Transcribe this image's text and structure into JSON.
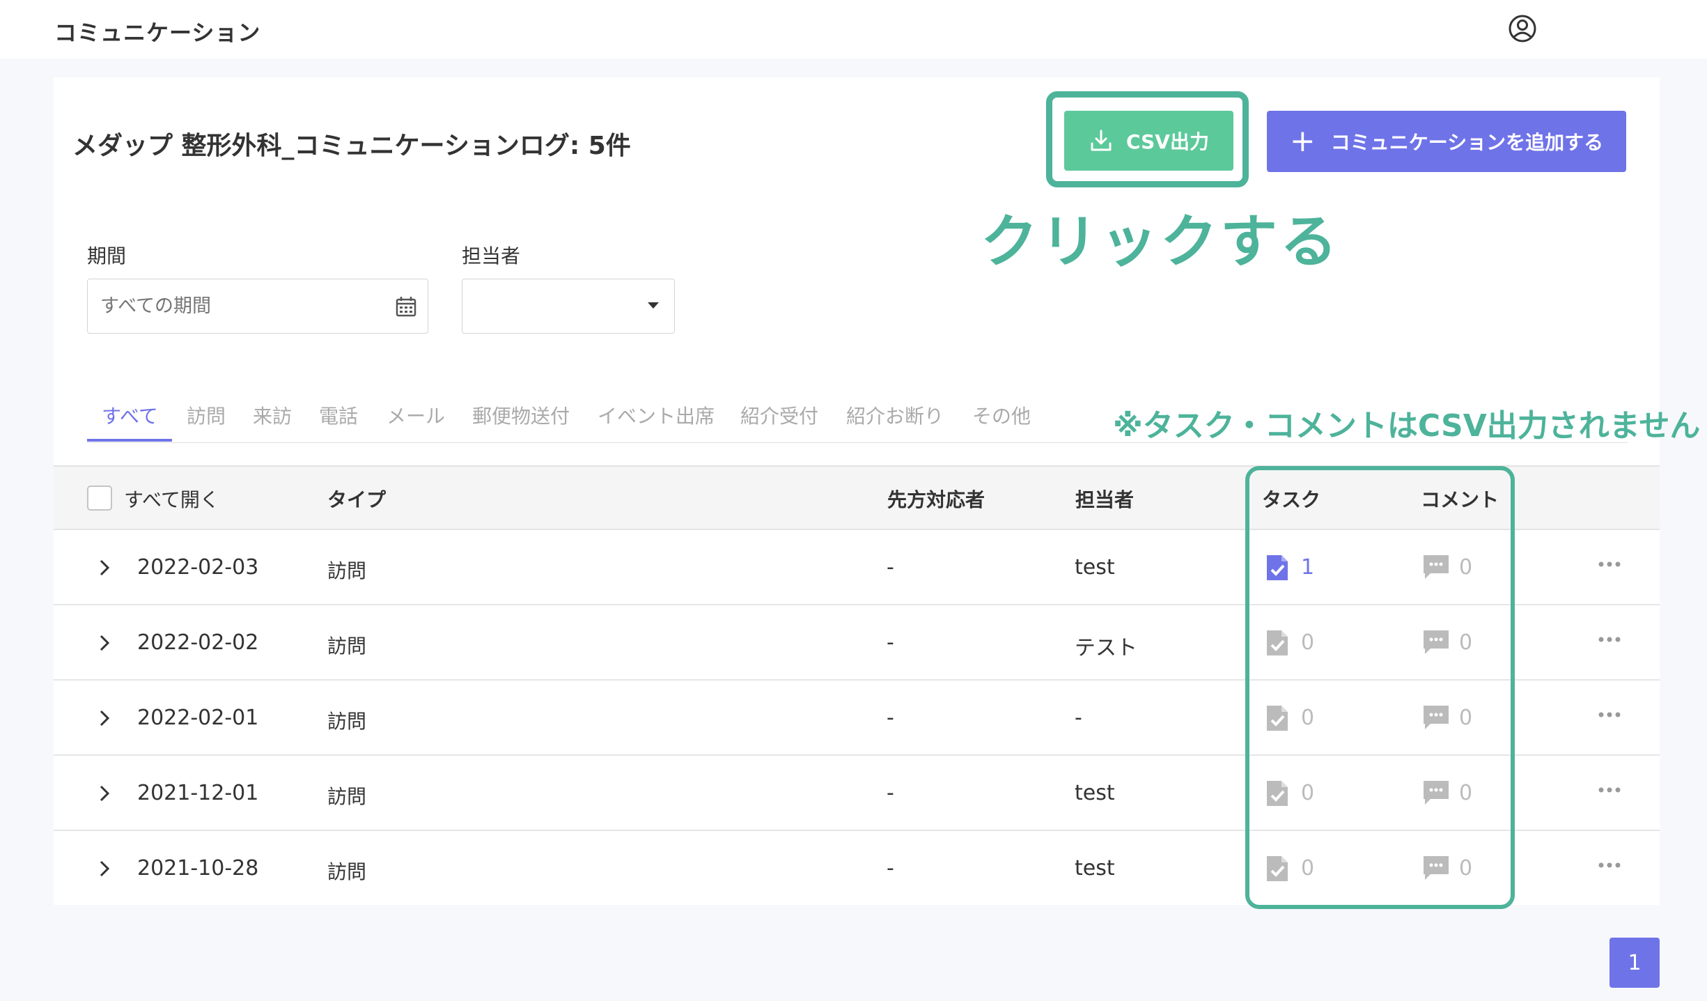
{
  "app": {
    "title": "コミュニケーション",
    "user_icon": "user-circle-icon"
  },
  "page": {
    "heading": "メダップ 整形外科_コミュニケーションログ: 5件"
  },
  "actions": {
    "csv_label": "CSV出力",
    "csv_icon": "download-icon",
    "add_label": "コミュニケーションを追加する",
    "add_icon": "plus-icon"
  },
  "annotations": {
    "click": "クリックする",
    "note": "※タスク・コメントはCSV出力されません",
    "color": "#4db39a"
  },
  "filters": {
    "period_label": "期間",
    "period_placeholder": "すべての期間",
    "assignee_label": "担当者",
    "assignee_value": ""
  },
  "tabs": [
    {
      "label": "すべて",
      "active": true
    },
    {
      "label": "訪問"
    },
    {
      "label": "来訪"
    },
    {
      "label": "電話"
    },
    {
      "label": "メール"
    },
    {
      "label": "郵便物送付"
    },
    {
      "label": "イベント出席"
    },
    {
      "label": "紹介受付"
    },
    {
      "label": "紹介お断り"
    },
    {
      "label": "その他"
    }
  ],
  "table": {
    "headers": {
      "expand_all": "すべて開く",
      "type": "タイプ",
      "counterpart": "先方対応者",
      "assignee": "担当者",
      "task": "タスク",
      "comment": "コメント"
    },
    "rows": [
      {
        "date": "2022-02-03",
        "type": "訪問",
        "counterpart": "-",
        "assignee": "test",
        "tasks": "1",
        "comments": "0",
        "task_active": true
      },
      {
        "date": "2022-02-02",
        "type": "訪問",
        "counterpart": "-",
        "assignee": "テスト",
        "tasks": "0",
        "comments": "0"
      },
      {
        "date": "2022-02-01",
        "type": "訪問",
        "counterpart": "-",
        "assignee": "-",
        "tasks": "0",
        "comments": "0"
      },
      {
        "date": "2021-12-01",
        "type": "訪問",
        "counterpart": "-",
        "assignee": "test",
        "tasks": "0",
        "comments": "0"
      },
      {
        "date": "2021-10-28",
        "type": "訪問",
        "counterpart": "-",
        "assignee": "test",
        "tasks": "0",
        "comments": "0"
      }
    ]
  },
  "pagination": {
    "current": "1"
  },
  "colors": {
    "primary": "#6f73e8",
    "csv_button": "#5cc99a",
    "inactive_icon": "#bbbbbb"
  }
}
